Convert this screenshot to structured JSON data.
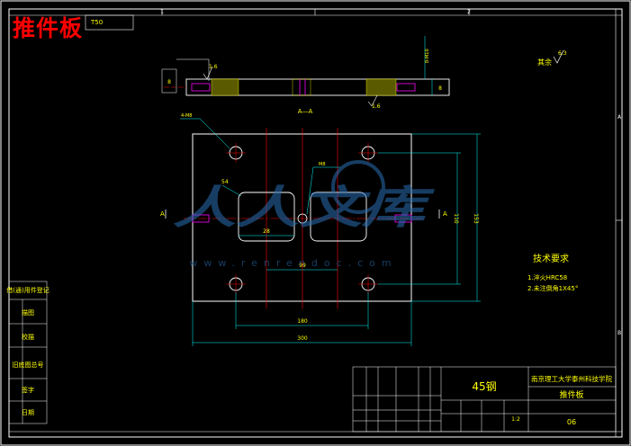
{
  "title": "推件板",
  "watermark": {
    "logo_text": "人人文库",
    "url_text": "www.renrendoc.com"
  },
  "colors": {
    "background": "#000000",
    "frame": "#ffffff",
    "object_line": "#ffffff",
    "dimension": "#00ffff",
    "center_line": "#ff0000",
    "hatch": "#ffff00",
    "text": "#ffff00"
  },
  "zones": {
    "top_1": "1",
    "top_2": "2",
    "side_a": "A",
    "side_b": "B"
  },
  "section": {
    "label": "A—A",
    "marker_a": "A"
  },
  "dims": {
    "len_300": "300",
    "len_180": "180",
    "len_99": "99",
    "len_28": "28",
    "h_153": "153",
    "h_110": "110",
    "r_54": "54",
    "holes": "4-M8",
    "center_hole": "M8",
    "th_side": "8",
    "section_top": "8-M10"
  },
  "roughness": {
    "rest_label": "其余",
    "rest_value": "6.3",
    "value_a": "1.6",
    "value_b": "1.6"
  },
  "tech": {
    "heading": "技术要求",
    "items": [
      "1.淬火HRC58",
      "2.未注倒角1X45°"
    ]
  },
  "sidebar": {
    "labels": [
      "借(通)用件登记",
      "描图",
      "校描",
      "旧底图总号",
      "签字",
      "日期"
    ]
  },
  "titleblock": {
    "material": "45钢",
    "school": "南京理工大学泰州科技学院",
    "name": "推件板",
    "number": "06",
    "scale": "1:2"
  },
  "partial_tag": "T50"
}
